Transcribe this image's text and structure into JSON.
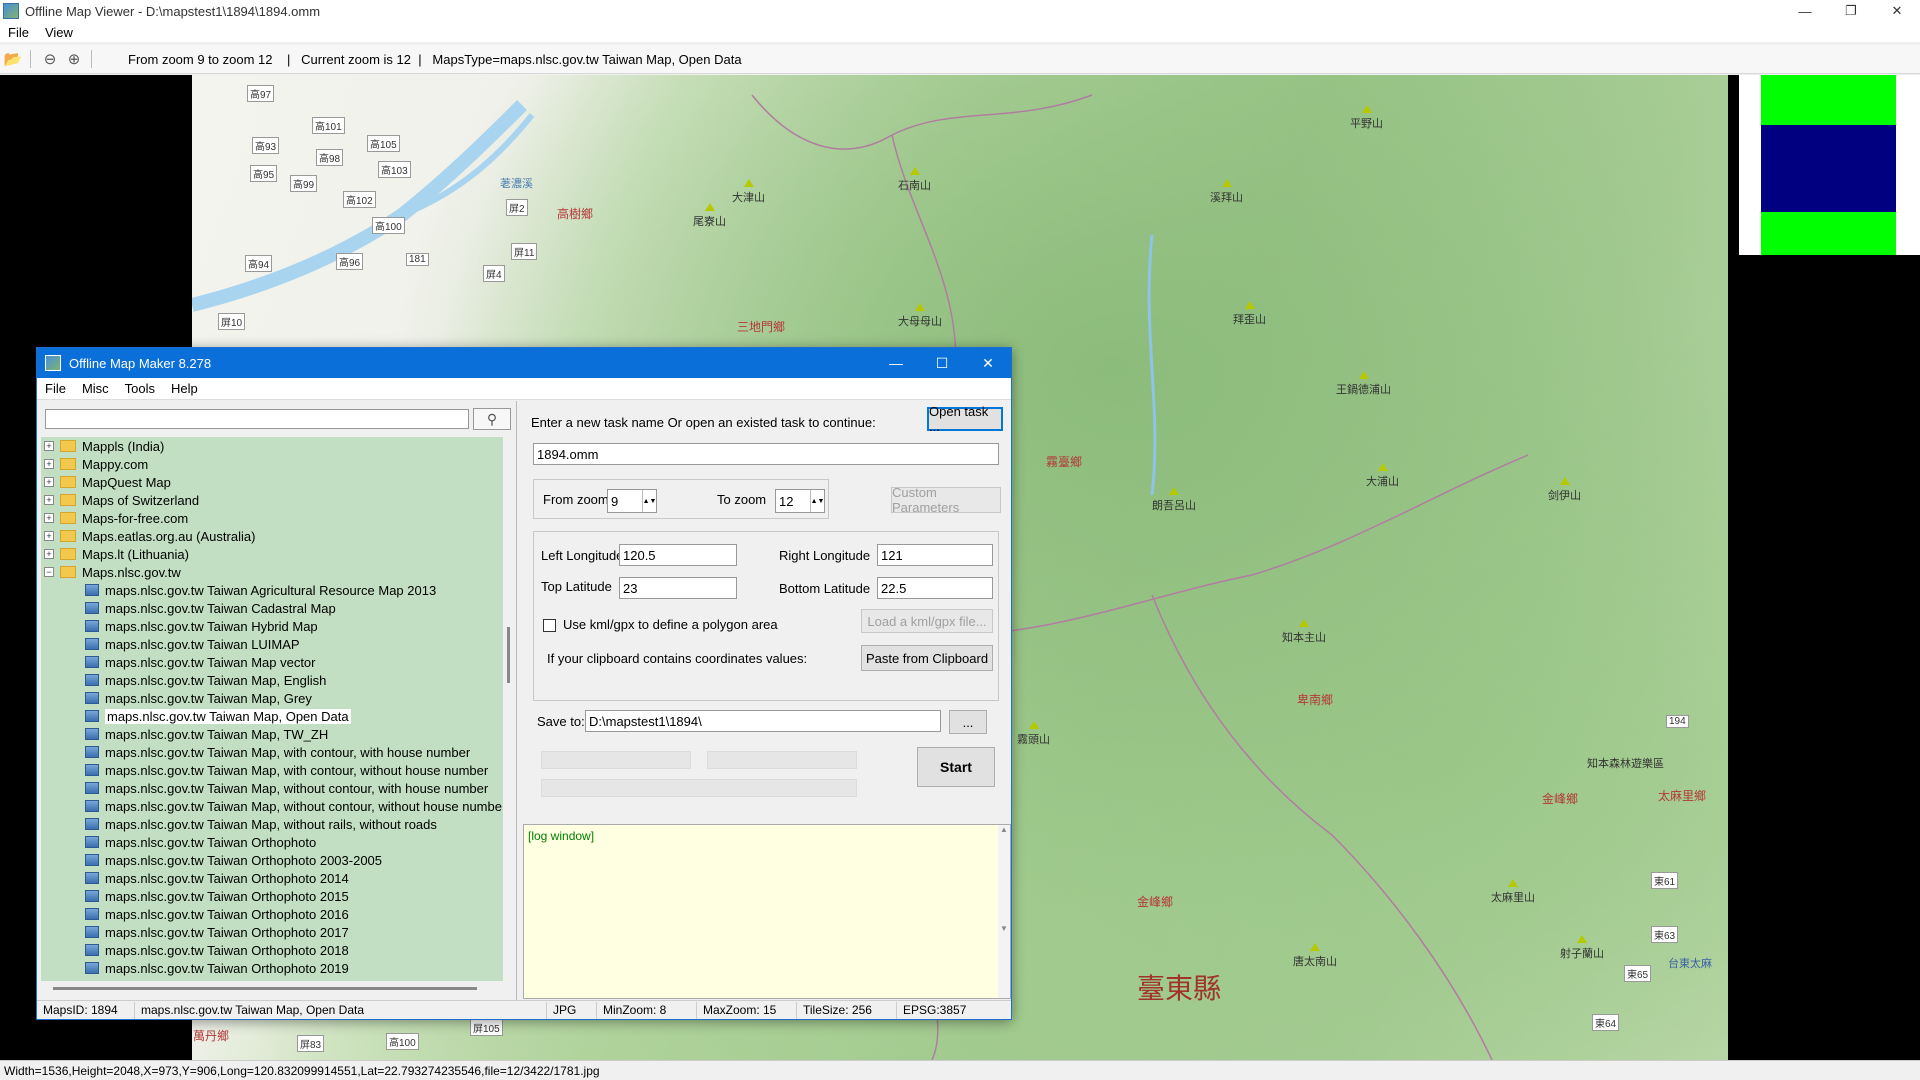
{
  "viewer": {
    "title": "Offline Map Viewer - D:\\mapstest1\\1894\\1894.omm",
    "menu": [
      "File",
      "View"
    ],
    "toolbar_info": "From zoom 9 to zoom 12    |   Current zoom is 12  |   MapsType=maps.nlsc.gov.tw Taiwan Map, Open Data",
    "status": "Width=1536,Height=2048,X=973,Y=906,Long=120.832099914551,Lat=22.793274235546,file=12/3422/1781.jpg"
  },
  "map_labels": {
    "peaks": [
      "大津山",
      "石南山",
      "尾寮山",
      "大母母山",
      "平野山",
      "溪拜山",
      "拜歪山",
      "王鍋德浦山",
      "大浦山",
      "朗吾呂山",
      "剑伊山",
      "知本主山",
      "霧頭山",
      "太麻里山",
      "唐太南山",
      "射子蘭山"
    ],
    "townships": [
      "高樹鄉",
      "三地門鄉",
      "霧臺鄉",
      "卑南鄉",
      "金峰鄉",
      "太麻里鄉",
      "金峰鄉",
      "萬丹鄉"
    ],
    "roads": [
      "高97",
      "高101",
      "高105",
      "高93",
      "高98",
      "高103",
      "高95",
      "高99",
      "高102",
      "高100",
      "高94",
      "高96",
      "181",
      "屏4",
      "屏11",
      "屏10",
      "屏2",
      "194",
      "東61",
      "東63",
      "東65",
      "東64",
      "屏83",
      "高100",
      "屏105"
    ],
    "rivers": [
      "荖濃溪"
    ],
    "pois": [
      "知本森林遊樂區",
      "台東太麻"
    ],
    "county": "臺東縣"
  },
  "dialog": {
    "title": "Offline Map Maker 8.278",
    "menu": [
      "File",
      "Misc",
      "Tools",
      "Help"
    ],
    "search": {
      "value": "",
      "placeholder": ""
    },
    "tree": {
      "folders": [
        "Mappls (India)",
        "Mappy.com",
        "MapQuest Map",
        "Maps of Switzerland",
        "Maps-for-free.com",
        "Maps.eatlas.org.au (Australia)",
        "Maps.lt (Lithuania)",
        "Maps.nlsc.gov.tw"
      ],
      "children": [
        "maps.nlsc.gov.tw Taiwan Agricultural Resource Map 2013",
        "maps.nlsc.gov.tw Taiwan Cadastral Map",
        "maps.nlsc.gov.tw Taiwan Hybrid Map",
        "maps.nlsc.gov.tw Taiwan LUIMAP",
        "maps.nlsc.gov.tw Taiwan Map vector",
        "maps.nlsc.gov.tw Taiwan Map, English",
        "maps.nlsc.gov.tw Taiwan Map, Grey",
        "maps.nlsc.gov.tw Taiwan Map, Open Data",
        "maps.nlsc.gov.tw Taiwan Map, TW_ZH",
        "maps.nlsc.gov.tw Taiwan Map, with contour, with house number",
        "maps.nlsc.gov.tw Taiwan Map, with contour, without house number",
        "maps.nlsc.gov.tw Taiwan Map, without contour, with house number",
        "maps.nlsc.gov.tw Taiwan Map, without contour, without house numbe",
        "maps.nlsc.gov.tw Taiwan Map, without rails, without roads",
        "maps.nlsc.gov.tw Taiwan Orthophoto",
        "maps.nlsc.gov.tw Taiwan Orthophoto 2003-2005",
        "maps.nlsc.gov.tw Taiwan Orthophoto 2014",
        "maps.nlsc.gov.tw Taiwan Orthophoto 2015",
        "maps.nlsc.gov.tw Taiwan Orthophoto 2016",
        "maps.nlsc.gov.tw Taiwan Orthophoto 2017",
        "maps.nlsc.gov.tw Taiwan Orthophoto 2018",
        "maps.nlsc.gov.tw Taiwan Orthophoto 2019"
      ],
      "selected": "maps.nlsc.gov.tw Taiwan Map, Open Data"
    },
    "task_prompt": "Enter a new task name Or open an existed task to continue:",
    "open_task_label": "Open task ...",
    "task_name": "1894.omm",
    "from_zoom_label": "From zoom",
    "from_zoom": "9",
    "to_zoom_label": "To zoom",
    "to_zoom": "12",
    "custom_params_label": "Custom Parameters",
    "left_lon_label": "Left Longitude",
    "left_lon": "120.5",
    "right_lon_label": "Right Longitude",
    "right_lon": "121",
    "top_lat_label": "Top Latitude",
    "top_lat": "23",
    "bottom_lat_label": "Bottom Latitude",
    "bottom_lat": "22.5",
    "kml_label": "Use kml/gpx to define a polygon area",
    "load_kml_label": "Load a kml/gpx file...",
    "clipboard_prompt": "If your clipboard contains coordinates values:",
    "paste_label": "Paste from Clipboard",
    "save_to_label": "Save to:",
    "save_to": "D:\\mapstest1\\1894\\",
    "browse_label": "...",
    "start_label": "Start",
    "log_label": "[log window]",
    "status": {
      "maps_id": "MapsID: 1894",
      "maps_type": "maps.nlsc.gov.tw Taiwan Map, Open Data",
      "format": "JPG",
      "min_zoom": "MinZoom: 8",
      "max_zoom": "MaxZoom: 15",
      "tile_size": "TileSize: 256",
      "epsg": "EPSG:3857"
    }
  },
  "colors": {
    "dialog_title_bg": "#0a6fd8",
    "tree_bg": "#c3dfc3",
    "log_bg": "#ffffe1",
    "legend_green": "#00ff00",
    "legend_navy": "#000080"
  }
}
